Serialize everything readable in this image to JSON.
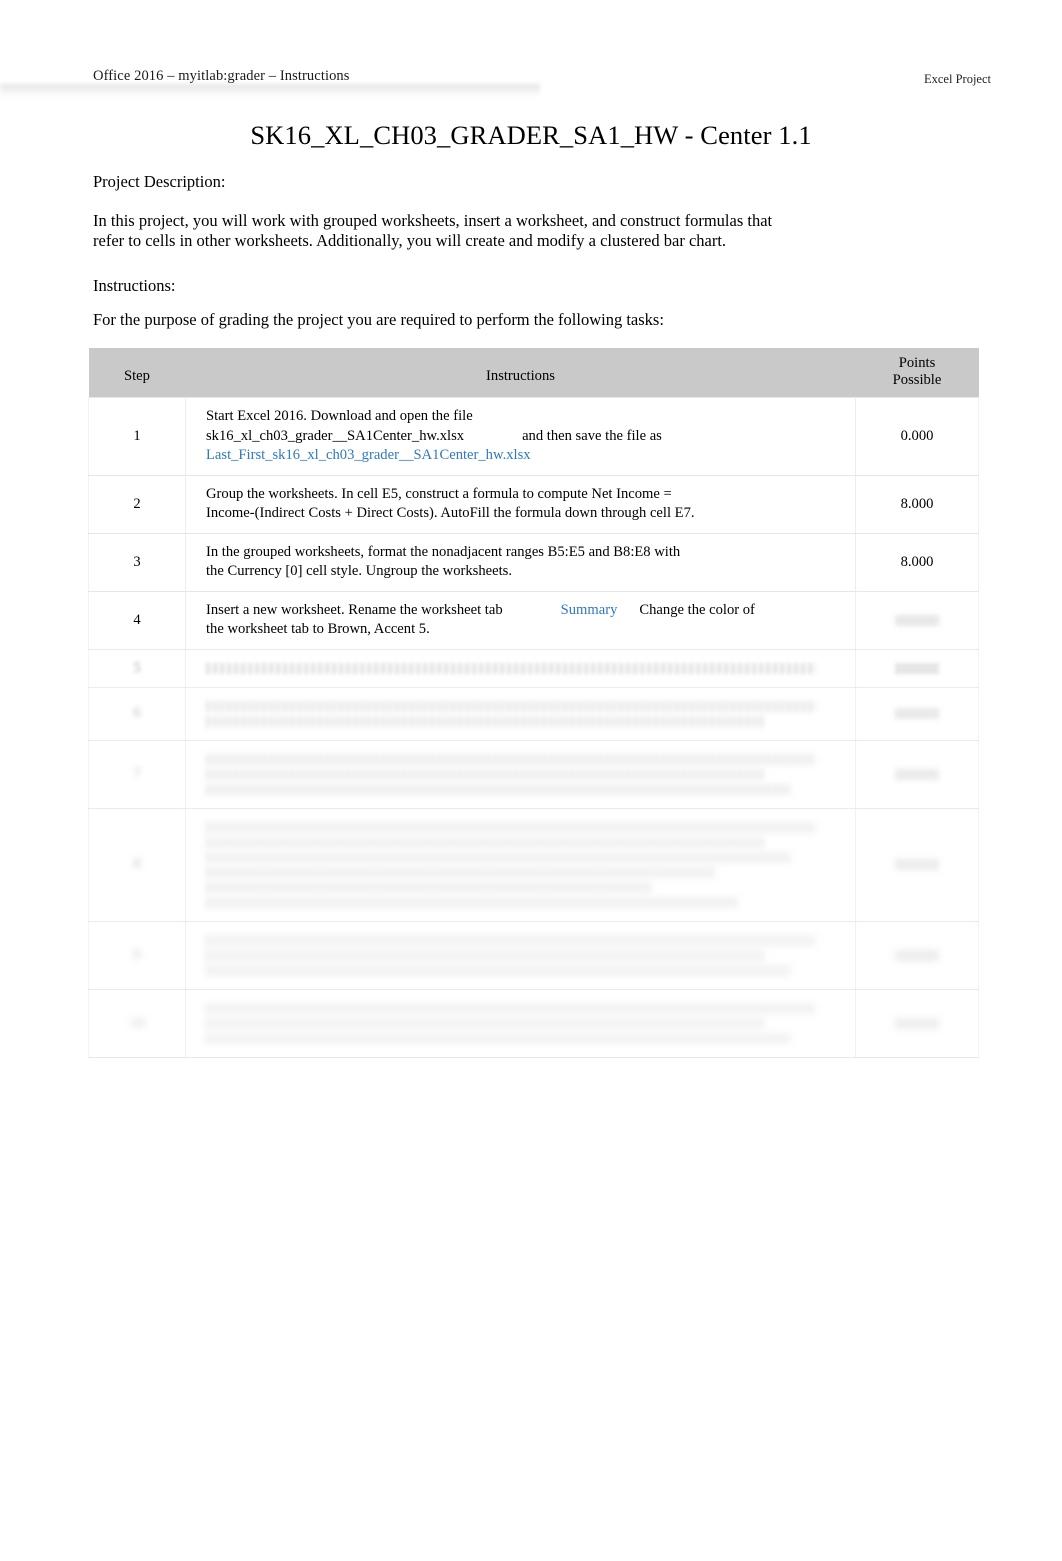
{
  "header": {
    "left": "Office 2016 – myitlab:grader – Instructions",
    "right": "Excel Project"
  },
  "title": "SK16_XL_CH03_GRADER_SA1_HW - Center 1.1",
  "sections": {
    "project_description_label": "Project Description:",
    "project_description_text": "In this project, you will work with grouped worksheets, insert a worksheet, and construct formulas that refer to cells in other worksheets. Additionally, you will create and modify a clustered bar chart.",
    "instructions_label": "Instructions:",
    "instructions_text": "For the purpose of grading the project you are required to perform the following tasks:"
  },
  "table": {
    "columns": {
      "step": "Step",
      "instructions": "Instructions",
      "points_line1": "Points",
      "points_line2": "Possible"
    },
    "rows": [
      {
        "step": "1",
        "points": "0.000",
        "parts": [
          {
            "text": "Start Excel 2016. Download and open the file",
            "style": "plain",
            "break_after": true
          },
          {
            "text": "sk16_xl_ch03_grader__SA1Center_hw.xlsx",
            "style": "plain"
          },
          {
            "text": "",
            "style": "gap"
          },
          {
            "text": "and then save the file as",
            "style": "plain",
            "break_after": true
          },
          {
            "text": "Last_First_sk16_xl_ch03_grader__SA1Center_hw.xlsx",
            "style": "link"
          }
        ]
      },
      {
        "step": "2",
        "points": "8.000",
        "parts": [
          {
            "text": "Group the worksheets. In cell E5, construct a formula to compute Net Income =",
            "style": "plain",
            "break_after": true
          },
          {
            "text": "Income-(Indirect Costs + Direct Costs). AutoFill the formula down through cell E7.",
            "style": "plain"
          }
        ]
      },
      {
        "step": "3",
        "points": "8.000",
        "parts": [
          {
            "text": "In the grouped worksheets, format the nonadjacent ranges B5:E5 and B8:E8 with",
            "style": "plain",
            "break_after": true
          },
          {
            "text": "the Currency [0] cell style. Ungroup the worksheets.",
            "style": "plain"
          }
        ]
      },
      {
        "step": "4",
        "points": "",
        "points_faded": true,
        "parts": [
          {
            "text": "Insert a new worksheet. Rename the worksheet tab",
            "style": "plain"
          },
          {
            "text": "",
            "style": "gap"
          },
          {
            "text": "Summary",
            "style": "link"
          },
          {
            "text": "",
            "style": "gap-small"
          },
          {
            "text": "Change the color of",
            "style": "plain",
            "break_after": true
          },
          {
            "text": "the worksheet tab to Brown, Accent 5.",
            "style": "plain"
          }
        ]
      },
      {
        "step": "5",
        "points": "",
        "faded": 1,
        "lines": 1
      },
      {
        "step": "6",
        "points": "",
        "faded": 2,
        "lines": 2
      },
      {
        "step": "7",
        "points": "",
        "faded": 3,
        "lines": 3
      },
      {
        "step": "8",
        "points": "",
        "faded": 4,
        "lines": 6
      },
      {
        "step": "9",
        "points": "",
        "faded": 5,
        "lines": 3
      },
      {
        "step": "10",
        "points": "",
        "faded": 6,
        "lines": 3
      }
    ]
  },
  "footer": {
    "left": "",
    "center": "",
    "right": ""
  },
  "colors": {
    "link": "#2e79c0",
    "table_header_bg": "#c9c9c9",
    "text": "#000000"
  }
}
